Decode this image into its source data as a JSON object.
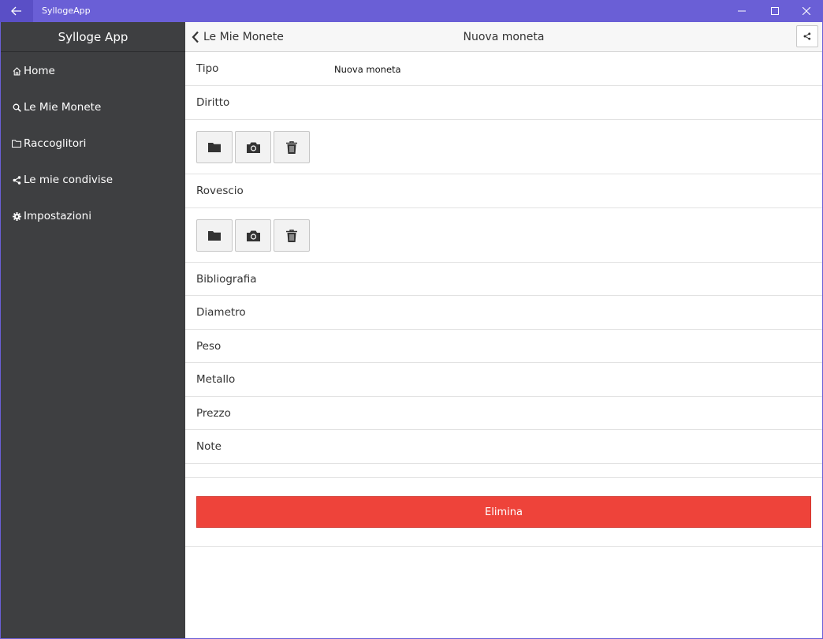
{
  "window": {
    "title": "SyllogeApp",
    "back_icon": "arrow-left-icon",
    "controls": [
      "minimize-icon",
      "maximize-icon",
      "close-icon"
    ]
  },
  "sidebar": {
    "title": "Sylloge App",
    "items": [
      {
        "label": "Home",
        "icon": "home-icon"
      },
      {
        "label": "Le Mie Monete",
        "icon": "search-icon"
      },
      {
        "label": "Raccoglitori",
        "icon": "folder-icon"
      },
      {
        "label": "Le mie condivise",
        "icon": "share-icon"
      },
      {
        "label": "Impostazioni",
        "icon": "gear-icon"
      }
    ]
  },
  "navbar": {
    "back_label": "Le Mie Monete",
    "title": "Nuova moneta",
    "share_icon": "share-icon"
  },
  "form": {
    "tipo": {
      "label": "Tipo",
      "value": "Nuova moneta"
    },
    "diritto": {
      "label": "Diritto"
    },
    "rovescio": {
      "label": "Rovescio"
    },
    "image_buttons": [
      "folder-icon",
      "camera-icon",
      "trash-icon"
    ],
    "fields": [
      {
        "label": "Bibliografia"
      },
      {
        "label": "Diametro"
      },
      {
        "label": "Peso"
      },
      {
        "label": "Metallo"
      },
      {
        "label": "Prezzo"
      },
      {
        "label": "Note"
      }
    ],
    "delete_label": "Elimina"
  },
  "colors": {
    "titlebar": "#6a5fd6",
    "sidebar": "#3e3f41",
    "delete": "#ee433a"
  }
}
